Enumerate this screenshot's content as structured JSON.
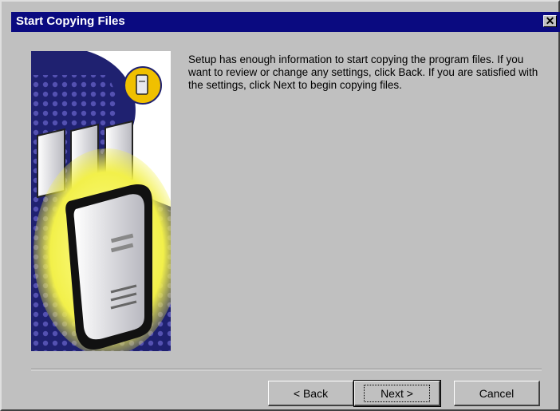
{
  "window": {
    "title": "Start Copying Files",
    "close_glyph": "✕"
  },
  "body": {
    "message": "Setup has enough information to start copying the program files. If you want to review or change any settings, click Back. If you are satisfied with the settings, click Next to begin copying files."
  },
  "buttons": {
    "back": "< Back",
    "next": "Next >",
    "cancel": "Cancel"
  },
  "colors": {
    "title_bar": "#0a0a80",
    "dialog_face": "#c0c0c0",
    "illustration_blue": "#1f2170",
    "glow_yellow": "#f2f04a"
  },
  "icons": [
    "server-illustration",
    "computer-badge-icon",
    "close-icon"
  ]
}
